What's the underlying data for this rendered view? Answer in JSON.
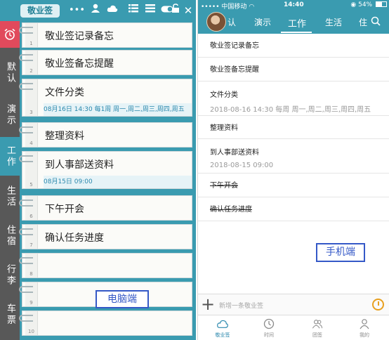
{
  "desktop": {
    "app_badge": "敬业签",
    "toolbar_icons": [
      "more-icon",
      "user-icon",
      "list-icon",
      "cloud-icon",
      "menu-icon",
      "toggle-icon",
      "unlock-icon",
      "close-icon"
    ],
    "tabs": [
      {
        "label": "",
        "icon": "alarm-clock-icon"
      },
      {
        "label": "默认"
      },
      {
        "label": "演示"
      },
      {
        "label": "工作",
        "active": true
      },
      {
        "label": "生活"
      },
      {
        "label": "住宿"
      },
      {
        "label": "行李"
      },
      {
        "label": "车票"
      }
    ],
    "notes": [
      {
        "num": "1",
        "title": "敬业签记录备忘"
      },
      {
        "num": "2",
        "title": "敬业签备忘提醒"
      },
      {
        "num": "3",
        "title": "文件分类",
        "sub": "08月16日 14:30 每1周 周一,周二,周三,周四,周五"
      },
      {
        "num": "4",
        "title": "整理资料"
      },
      {
        "num": "5",
        "title": "到人事部送资料",
        "sub": "08月15日 09:00"
      },
      {
        "num": "6",
        "title": "下午开会"
      },
      {
        "num": "7",
        "title": "确认任务进度"
      },
      {
        "num": "8",
        "title": ""
      },
      {
        "num": "9",
        "title": ""
      },
      {
        "num": "10",
        "title": ""
      }
    ],
    "label": "电脑端"
  },
  "mobile": {
    "status": {
      "carrier": "中国移动",
      "time": "14:40",
      "battery": "54%"
    },
    "tabs": [
      "认",
      "演示",
      "工作",
      "生活",
      "住"
    ],
    "active_tab": "工作",
    "items": [
      {
        "title": "敬业签记录备忘"
      },
      {
        "title": "敬业签备忘提醒"
      },
      {
        "title": "文件分类",
        "sub": "2018-08-16 14:30 每周 周一,周二,周三,周四,周五"
      },
      {
        "title": "整理资料"
      },
      {
        "title": "到人事部送资料",
        "sub": "2018-08-15 09:00"
      },
      {
        "title": "下午开会",
        "done": true
      },
      {
        "title": "确认任务进度",
        "done": true
      }
    ],
    "label": "手机端",
    "compose_placeholder": "新增一条敬业签",
    "nav": [
      {
        "label": "敬业签",
        "icon": "cloud-note-icon",
        "active": true
      },
      {
        "label": "时间",
        "icon": "clock-icon"
      },
      {
        "label": "团签",
        "icon": "team-icon"
      },
      {
        "label": "我的",
        "icon": "person-icon"
      }
    ]
  },
  "colors": {
    "teal": "#3a9bb0",
    "tab_gray": "#585858",
    "alarm_red": "#e14a5c",
    "label_blue": "#3559c7"
  }
}
